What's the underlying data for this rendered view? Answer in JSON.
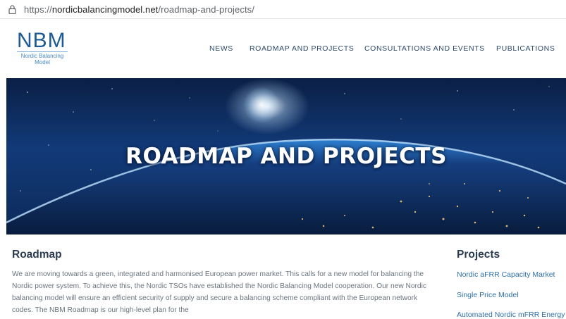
{
  "browser": {
    "url_prefix": "https://",
    "url_domain": "nordicbalancingmodel.net",
    "url_path": "/roadmap-and-projects/"
  },
  "header": {
    "logo_mark": "NBM",
    "logo_sub": "Nordic Balancing Model",
    "nav": [
      "NEWS",
      "ROADMAP AND PROJECTS",
      "CONSULTATIONS AND EVENTS",
      "PUBLICATIONS"
    ]
  },
  "hero": {
    "title": "ROADMAP AND PROJECTS"
  },
  "roadmap": {
    "heading": "Roadmap",
    "body": "We are moving towards a green, integrated and harmonised European power market. This calls for a new model for balancing the Nordic power system. To achieve this, the Nordic TSOs have established the Nordic Balancing Model cooperation. Our new Nordic balancing model will ensure an efficient security of supply and secure a balancing scheme compliant with the European network codes. The NBM Roadmap is our high-level plan for the"
  },
  "projects": {
    "heading": "Projects",
    "items": [
      "Nordic aFRR Capacity Market",
      "Single Price Model",
      "Automated Nordic mFRR Energy"
    ]
  },
  "colors": {
    "nav_text": "#2e4a6b",
    "heading": "#2a3b52",
    "link": "#2f6fa8",
    "logo_blue": "#1e5a93"
  },
  "icons": [
    "lock-icon"
  ]
}
